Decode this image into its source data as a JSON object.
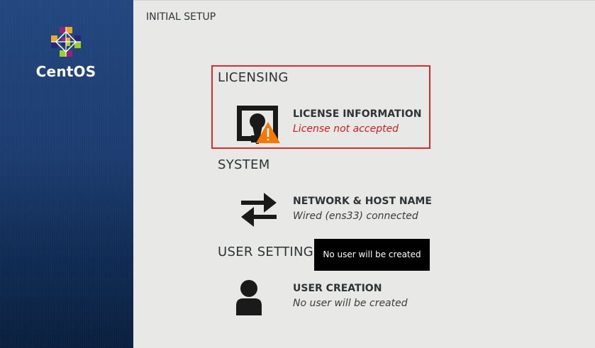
{
  "sidebar": {
    "brand": "CentOS"
  },
  "header": {
    "title": "INITIAL SETUP"
  },
  "categories": [
    {
      "label": "LICENSING",
      "spokes": [
        {
          "name": "LICENSE INFORMATION",
          "status": "License not accepted",
          "icon": "license-warning-icon"
        }
      ]
    },
    {
      "label": "SYSTEM",
      "spokes": [
        {
          "name": "NETWORK & HOST NAME",
          "status": "Wired (ens33) connected",
          "icon": "network-arrows-icon"
        }
      ]
    },
    {
      "label": "USER SETTING",
      "spokes": [
        {
          "name": "USER CREATION",
          "status": "No user will be created",
          "icon": "user-icon"
        }
      ]
    }
  ],
  "tooltip": {
    "text": "No user will be created"
  },
  "colors": {
    "sidebar": "#1c3c6f",
    "background": "#e8e8e7",
    "warning_text": "#cc1f1f",
    "highlight_border": "#d92b2b",
    "warning_icon": "#f57900"
  }
}
